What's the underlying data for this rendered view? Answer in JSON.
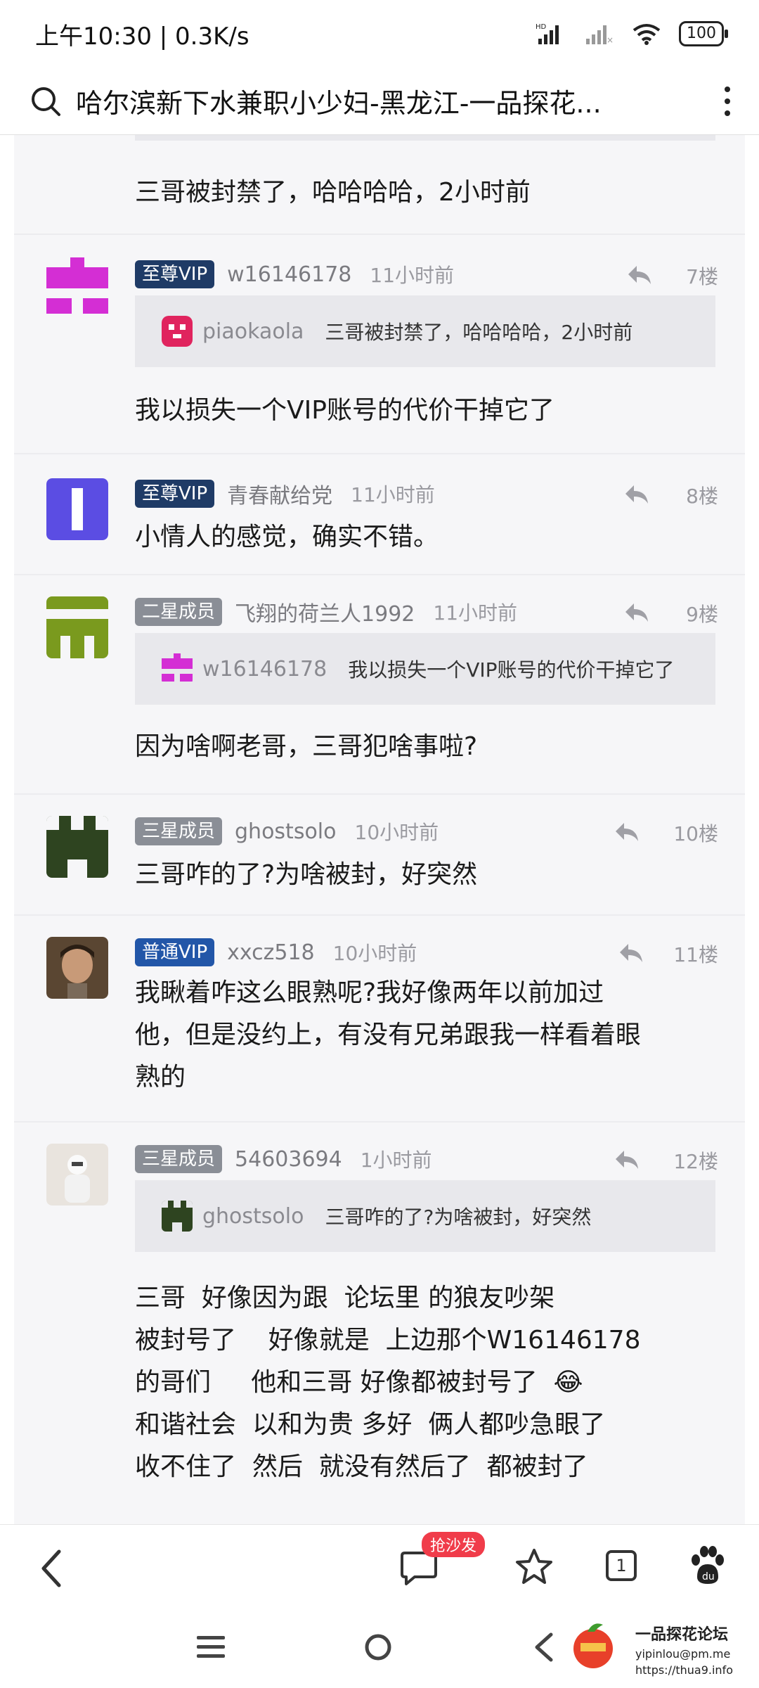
{
  "status_bar": {
    "time_speed": "上午10:30 | 0.3K/s",
    "battery": "100"
  },
  "address_bar": {
    "title": "哈尔滨新下水兼职小少妇-黑龙江-一品探花..."
  },
  "top_partial": {
    "text": "三哥被封禁了，哈哈哈哈，2小时前"
  },
  "posts": [
    {
      "badge": "至尊VIP",
      "badge_color": "#1f3b66",
      "user": "w16146178",
      "time": "11小时前",
      "floor": "7楼",
      "quote": {
        "user": "piaokaola",
        "text": "三哥被封禁了，哈哈哈哈，2小时前"
      },
      "text": "我以损失一个VIP账号的代价干掉它了"
    },
    {
      "badge": "至尊VIP",
      "badge_color": "#1f3b66",
      "user": "青春献给党",
      "time": "11小时前",
      "floor": "8楼",
      "text": "小情人的感觉，确实不错。"
    },
    {
      "badge": "二星成员",
      "badge_color": "#8a8e96",
      "user": "飞翔的荷兰人1992",
      "time": "11小时前",
      "floor": "9楼",
      "quote": {
        "user": "w16146178",
        "text": "我以损失一个VIP账号的代价干掉它了"
      },
      "text": "因为啥啊老哥，三哥犯啥事啦?"
    },
    {
      "badge": "三星成员",
      "badge_color": "#8a8e96",
      "user": "ghostsolo",
      "time": "10小时前",
      "floor": "10楼",
      "text": "三哥咋的了?为啥被封，好突然"
    },
    {
      "badge": "普通VIP",
      "badge_color": "#2256a8",
      "user": "xxcz518",
      "time": "10小时前",
      "floor": "11楼",
      "text_lines": [
        "我瞅着咋这么眼熟呢?我好像两年以前加过",
        "他，但是没约上，有没有兄弟跟我一样看着眼",
        "熟的"
      ]
    },
    {
      "badge": "三星成员",
      "badge_color": "#8a8e96",
      "user": "54603694",
      "time": "1小时前",
      "floor": "12楼",
      "quote": {
        "user": "ghostsolo",
        "text": "三哥咋的了?为啥被封，好突然"
      },
      "text_lines": [
        "三哥  好像因为跟  论坛里 的狼友吵架",
        "被封号了    好像就是  上边那个W16146178",
        "的哥们     他和三哥 好像都被封号了  😂",
        "和谐社会  以和为贵 多好  俩人都吵急眼了",
        "收不住了  然后  就没有然后了  都被封了"
      ]
    }
  ],
  "toolbar": {
    "sofa_label": "抢沙发",
    "tab_count": "1"
  },
  "watermark": {
    "line1": "一品探花论坛",
    "line2": "yipinlou@pm.me",
    "line3": "https://thua9.info"
  },
  "icons": {
    "search": "search-icon",
    "more": "more-vertical-icon",
    "reply": "reply-arrow-icon",
    "back": "back-arrow-icon",
    "comment": "comment-icon",
    "star": "star-icon",
    "tabs": "tabs-icon",
    "baidu": "baidu-paw-icon"
  }
}
